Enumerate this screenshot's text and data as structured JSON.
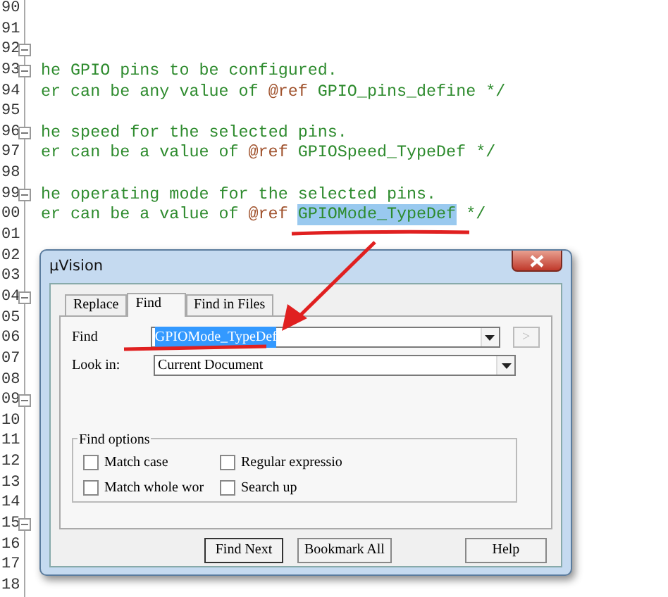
{
  "editor": {
    "lines": [
      {
        "number": "90",
        "fold": false
      },
      {
        "number": "91",
        "fold": false
      },
      {
        "number": "92",
        "fold": true
      },
      {
        "number": "93",
        "fold": true,
        "parts": [
          {
            "kind": "comment",
            "text": "he GPIO pins to be configured."
          }
        ]
      },
      {
        "number": "94",
        "fold": false,
        "parts": [
          {
            "kind": "comment",
            "text": "er can be any value of"
          },
          {
            "kind": "ref",
            "text": "@ref"
          },
          {
            "kind": "comment",
            "text": "GPIO_pins_define */"
          }
        ]
      },
      {
        "number": "95",
        "fold": false
      },
      {
        "number": "96",
        "fold": true,
        "parts": [
          {
            "kind": "comment",
            "text": "he speed for the selected pins."
          }
        ]
      },
      {
        "number": "97",
        "fold": false,
        "parts": [
          {
            "kind": "comment",
            "text": "er can be a value of"
          },
          {
            "kind": "ref",
            "text": "@ref"
          },
          {
            "kind": "comment",
            "text": "GPIOSpeed_TypeDef */"
          }
        ]
      },
      {
        "number": "98",
        "fold": false
      },
      {
        "number": "99",
        "fold": true,
        "parts": [
          {
            "kind": "comment",
            "text": "he operating mode for the selected pins."
          }
        ]
      },
      {
        "number": "00",
        "fold": false,
        "parts": [
          {
            "kind": "comment",
            "text": "er can be a value of"
          },
          {
            "kind": "ref",
            "text": "@ref"
          },
          {
            "kind": "selection",
            "text": "GPIOMode_TypeDef"
          },
          {
            "kind": "comment",
            "text": "*/"
          }
        ]
      },
      {
        "number": "01",
        "fold": false
      },
      {
        "number": "02",
        "fold": false
      },
      {
        "number": "03",
        "fold": false
      },
      {
        "number": "04",
        "fold": true
      },
      {
        "number": "05",
        "fold": false
      },
      {
        "number": "06",
        "fold": false
      },
      {
        "number": "07",
        "fold": false
      },
      {
        "number": "08",
        "fold": false
      },
      {
        "number": "09",
        "fold": true
      },
      {
        "number": "10",
        "fold": false
      },
      {
        "number": "11",
        "fold": false
      },
      {
        "number": "12",
        "fold": false
      },
      {
        "number": "13",
        "fold": false
      },
      {
        "number": "14",
        "fold": false
      },
      {
        "number": "15",
        "fold": true
      },
      {
        "number": "16",
        "fold": false
      },
      {
        "number": "17",
        "fold": false
      },
      {
        "number": "18",
        "fold": false
      }
    ]
  },
  "dialog": {
    "title": "µVision",
    "tabs": [
      {
        "label": "Replace",
        "selected": false
      },
      {
        "label": "Find",
        "selected": true
      },
      {
        "label": "Find in Files",
        "selected": false
      }
    ],
    "find": {
      "label": "Find",
      "value": "GPIOMode_TypeDef",
      "selected": true
    },
    "browse_button": {
      "label": ">",
      "disabled": true
    },
    "look_in": {
      "label": "Look in:",
      "value": "Current Document"
    },
    "options_title": "Find options",
    "options": [
      {
        "label": "Match case",
        "checked": false
      },
      {
        "label": "Regular expressio",
        "checked": false
      },
      {
        "label": "Match whole wor",
        "checked": false
      },
      {
        "label": "Search up",
        "checked": false
      }
    ],
    "buttons": [
      {
        "label": "Find Next",
        "kind": "default"
      },
      {
        "label": "Bookmark All",
        "kind": "normal"
      },
      {
        "label": "Help",
        "kind": "spaced"
      }
    ]
  }
}
